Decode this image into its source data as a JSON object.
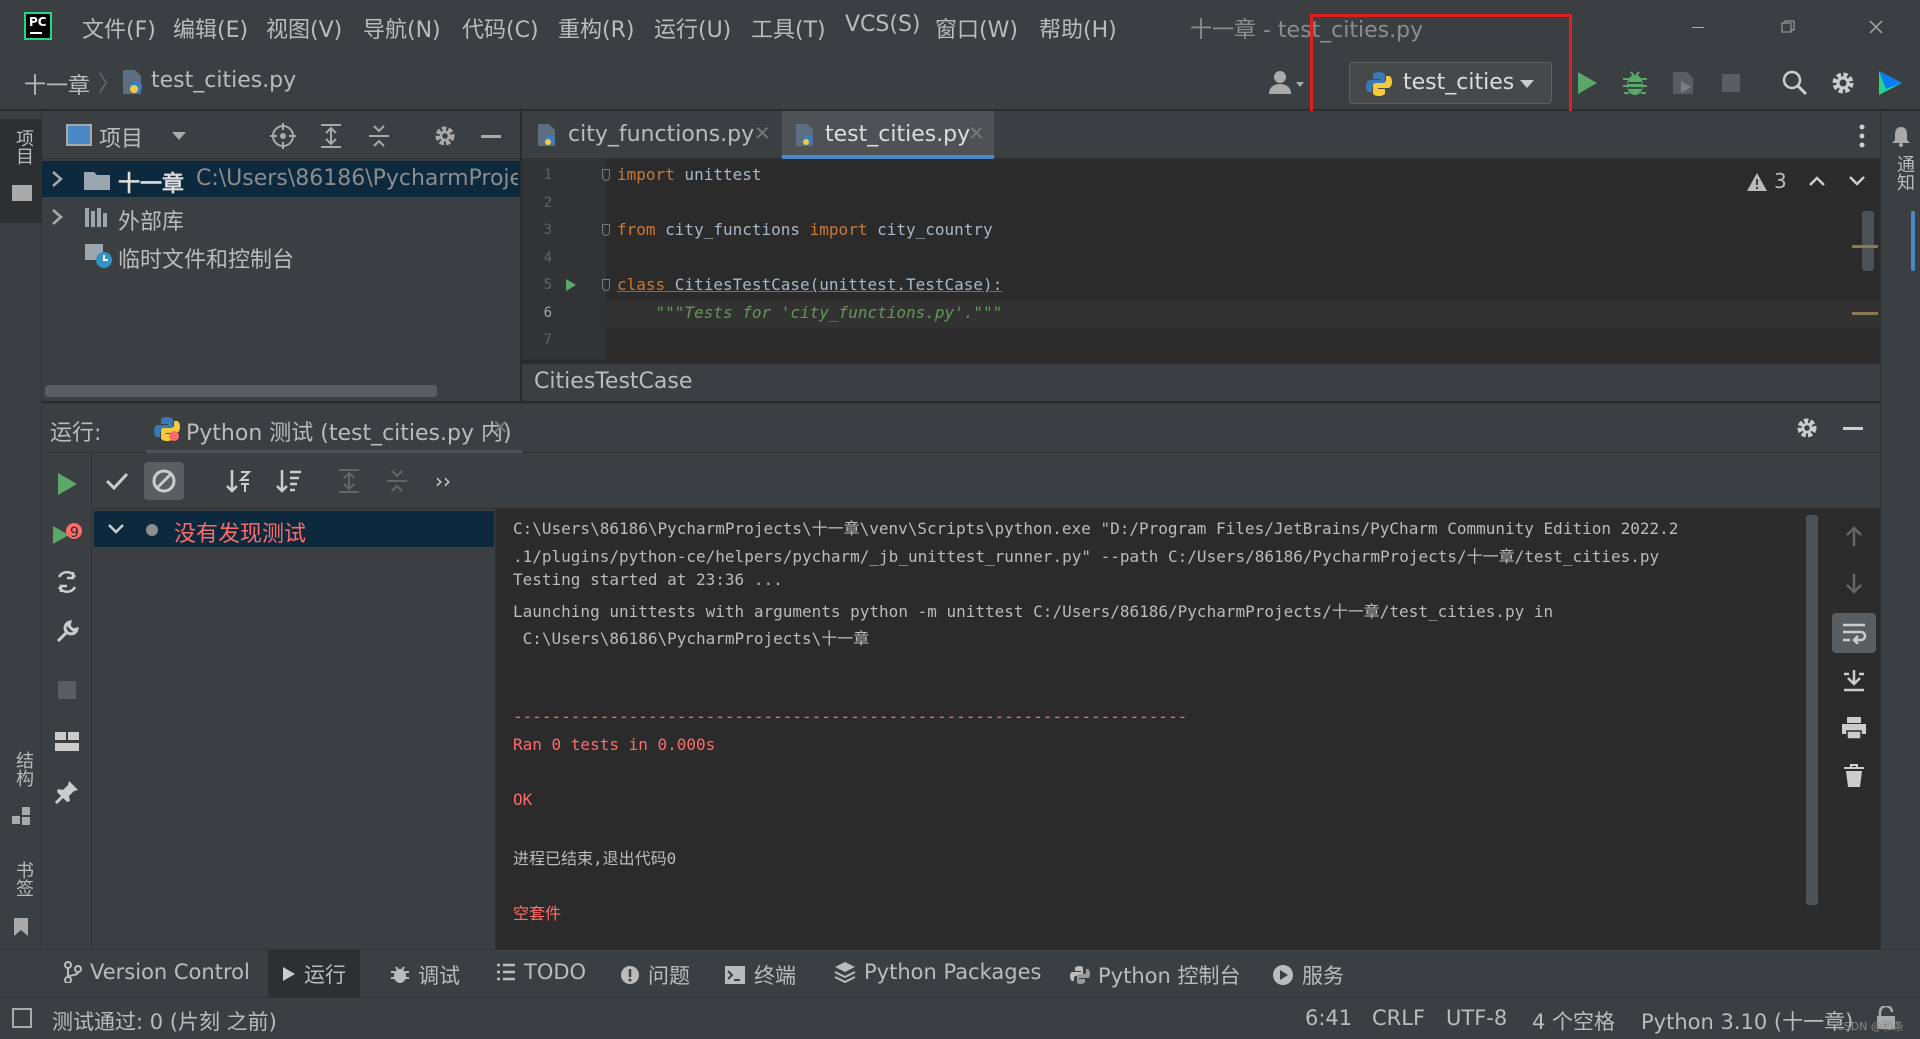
{
  "app": {
    "window_title": "十一章 - test_cities.py",
    "logo_text": "PC",
    "menu": [
      "文件(F)",
      "编辑(E)",
      "视图(V)",
      "导航(N)",
      "代码(C)",
      "重构(R)",
      "运行(U)",
      "工具(T)",
      "VCS(S)",
      "窗口(W)",
      "帮助(H)"
    ]
  },
  "navbar": {
    "breadcrumb_root": "十一章",
    "breadcrumb_file": "test_cities.py",
    "run_config": "test_cities"
  },
  "project": {
    "title": "项目",
    "tree": [
      {
        "label": "十一章",
        "path": "C:\\Users\\86186\\PycharmProjec"
      },
      {
        "label": "外部库"
      },
      {
        "label": "临时文件和控制台"
      }
    ]
  },
  "left_strip": {
    "project": "项目",
    "structure": "结构",
    "bookmarks": "书签"
  },
  "right_strip": {
    "notifications": "通知"
  },
  "editor": {
    "tabs": [
      {
        "label": "city_functions.py",
        "active": false
      },
      {
        "label": "test_cities.py",
        "active": true
      }
    ],
    "warning_count": "3",
    "line_numbers": [
      "1",
      "2",
      "3",
      "4",
      "5",
      "6",
      "7"
    ],
    "lines": {
      "l1_kw": "import",
      "l1_rest": " unittest",
      "l3_kw1": "from",
      "l3_mod": " city_functions ",
      "l3_kw2": "import",
      "l3_rest": " city_country",
      "l5_kw": "class",
      "l5_rest": " CitiesTestCase(unittest.TestCase):",
      "l6": "    \"\"\"Tests for 'city_functions.py'.\"\"\""
    },
    "breadcrumb": "CitiesTestCase"
  },
  "run": {
    "label": "运行:",
    "tab": "Python 测试 (test_cities.py 内)",
    "tree_item": "没有发现测试",
    "console": [
      "C:\\Users\\86186\\PycharmProjects\\十一章\\venv\\Scripts\\python.exe \"D:/Program Files/JetBrains/PyCharm Community Edition 2022.2",
      ".1/plugins/python-ce/helpers/pycharm/_jb_unittest_runner.py\" --path C:/Users/86186/PycharmProjects/十一章/test_cities.py",
      "Testing started at 23:36 ...",
      "Launching unittests with arguments python -m unittest C:/Users/86186/PycharmProjects/十一章/test_cities.py in",
      " C:\\Users\\86186\\PycharmProjects\\十一章",
      "----------------------------------------------------------------------",
      "Ran 0 tests in 0.000s",
      "OK",
      "进程已结束,退出代码0",
      "空套件"
    ]
  },
  "toolwindows": [
    "Version Control",
    "运行",
    "调试",
    "TODO",
    "问题",
    "终端",
    "Python Packages",
    "Python 控制台",
    "服务"
  ],
  "status": {
    "message": "测试通过: 0 (片刻 之前)",
    "position": "6:41",
    "line_sep": "CRLF",
    "encoding": "UTF-8",
    "indent": "4 个空格",
    "interpreter": "Python 3.10 (十一章)"
  },
  "watermark": "CSDN @和条",
  "colors": {
    "highlight": "#e02020",
    "accent": "#4a88c7",
    "run_green": "#59a869",
    "error_red": "#ff6b68"
  }
}
